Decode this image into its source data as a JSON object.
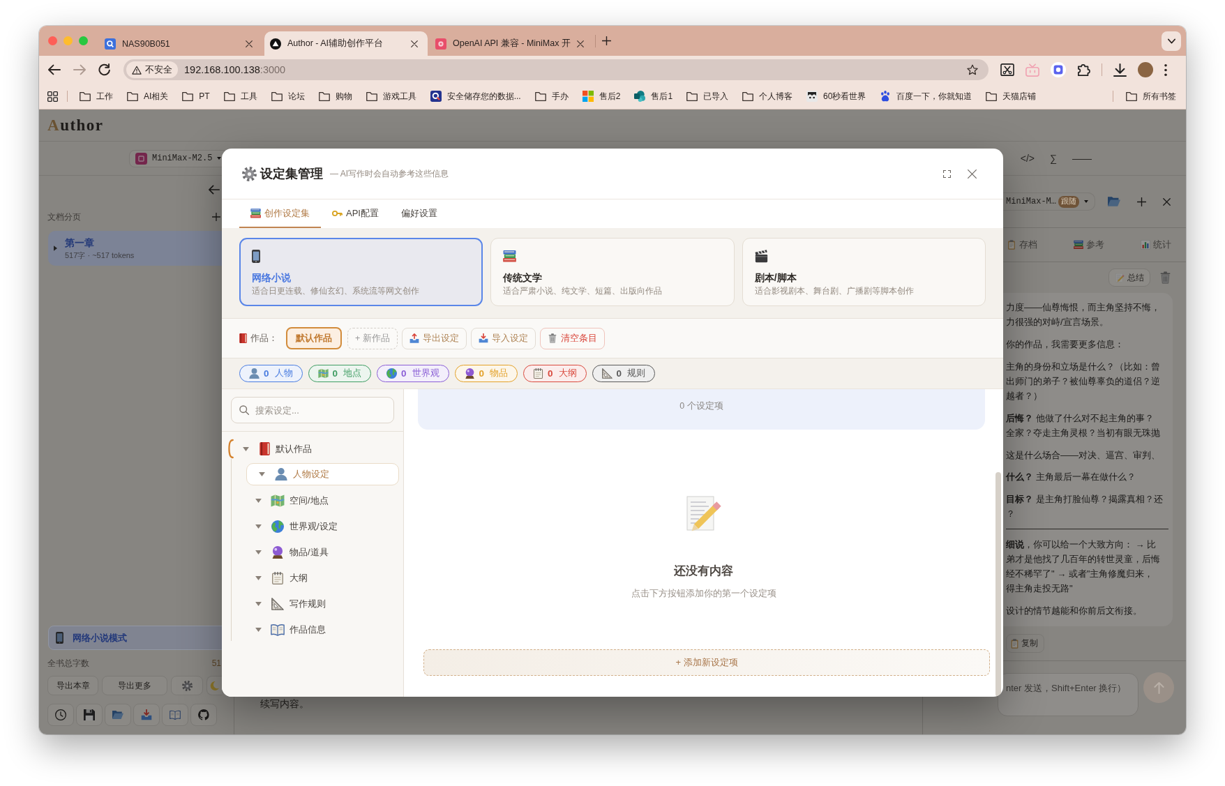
{
  "browser": {
    "tabs": [
      {
        "title": "NAS90B051",
        "selected": false
      },
      {
        "title": "Author - AI辅助创作平台",
        "selected": true
      },
      {
        "title": "OpenAI API 兼容 - MiniMax 开",
        "selected": false
      }
    ],
    "navigation": [
      {
        "kind": "back",
        "disabled": false
      },
      {
        "kind": "forward",
        "disabled": true
      },
      {
        "kind": "reload",
        "disabled": false
      }
    ],
    "address": {
      "security": "不安全",
      "host": "192.168.100.138",
      "port": ":3000"
    },
    "bookmarks": [
      {
        "kind": "folder",
        "label": "工作"
      },
      {
        "kind": "folder",
        "label": "AI相关"
      },
      {
        "kind": "folder",
        "label": "PT"
      },
      {
        "kind": "folder",
        "label": "工具"
      },
      {
        "kind": "folder",
        "label": "论坛"
      },
      {
        "kind": "folder",
        "label": "购物"
      },
      {
        "kind": "folder",
        "label": "游戏工具"
      },
      {
        "kind": "site",
        "label": "安全储存您的数据..."
      },
      {
        "kind": "folder",
        "label": "手办"
      },
      {
        "kind": "site",
        "label": "售后2"
      },
      {
        "kind": "site",
        "label": "售后1"
      },
      {
        "kind": "folder",
        "label": "已导入"
      },
      {
        "kind": "folder",
        "label": "个人博客"
      },
      {
        "kind": "site",
        "label": "60秒看世界"
      },
      {
        "kind": "site",
        "label": "百度一下，你就知道"
      },
      {
        "kind": "folder",
        "label": "天猫店铺"
      }
    ],
    "all_bookmarks": "所有书签"
  },
  "app": {
    "logo": "Author",
    "model": "MiniMax-M2.5",
    "tools": [
      "</>",
      "∑",
      "——"
    ],
    "sidebar": {
      "section_title": "文档分页",
      "chapters": [
        {
          "title": "第一章",
          "meta": "517字 · ~517 tokens",
          "selected": true,
          "expanded": false
        }
      ],
      "mode": "网络小说模式",
      "total_label": "全书总字数",
      "total_value": "51",
      "buttons": [
        "导出本章",
        "导出更多"
      ]
    },
    "editor": {
      "text": "续写内容。"
    },
    "assistant": {
      "model": "MiniMax-M…",
      "badge": "跟随",
      "tabs": [
        {
          "kind": "archive",
          "label": "存档"
        },
        {
          "kind": "reference",
          "label": "参考"
        },
        {
          "kind": "stats",
          "label": "统计"
        }
      ],
      "summary_button": "总结",
      "message": [
        {
          "kind": "paragraph",
          "lines": [
            "力度——仙尊悔恨，而主角坚持不悔，",
            "力很强的对峙/宣言场景。"
          ]
        },
        {
          "kind": "paragraph",
          "lines": [
            "你的作品，我需要更多信息："
          ]
        },
        {
          "kind": "item",
          "lines": [
            "主角的身份和立场是什么？（比如：曾",
            "出师门的弟子？被仙尊辜负的道侣？逆",
            "越者？）"
          ]
        },
        {
          "kind": "item",
          "lines": [
            "**后悔？** 他做了什么对不起主角的事？",
            "全家？夺走主角灵根？当初有眼无珠抛"
          ]
        },
        {
          "kind": "item",
          "lines": [
            "这是什么场合——对决、逼宫、审判、"
          ]
        },
        {
          "kind": "item",
          "lines": [
            "**什么？** 主角最后一幕在做什么？"
          ]
        },
        {
          "kind": "item",
          "lines": [
            "**目标？** 是主角打脸仙尊？揭露真相？还",
            "？"
          ]
        },
        {
          "kind": "rule"
        },
        {
          "kind": "paragraph",
          "lines": [
            "**细说**，你可以给一个大致方向： → 比",
            "弟才是他找了几百年的转世灵童，后悔",
            "经不稀罕了\" → 或者\"主角修魔归来，",
            "得主角走投无路\""
          ]
        },
        {
          "kind": "paragraph",
          "lines": [
            "设计的情节越能和你前后文衔接。"
          ]
        }
      ],
      "copy_button": "复制",
      "input": {
        "placeholder": "nter 发送，Shift+Enter 换行）"
      }
    }
  },
  "dialog": {
    "title": "设定集管理",
    "subtitle": "— AI写作时会自动参考这些信息",
    "tabs": [
      {
        "kind": "settings",
        "label": "创作设定集",
        "selected": true
      },
      {
        "kind": "api",
        "label": "API配置",
        "selected": false
      },
      {
        "kind": "preferences",
        "label": "偏好设置",
        "selected": false
      }
    ],
    "modes": [
      {
        "kind": "web-novel",
        "title": "网络小说",
        "description": "适合日更连载、修仙玄幻、系统流等网文创作",
        "selected": true
      },
      {
        "kind": "literature",
        "title": "传统文学",
        "description": "适合严肃小说、纯文学、短篇、出版向作品",
        "selected": false
      },
      {
        "kind": "script",
        "title": "剧本/脚本",
        "description": "适合影视剧本、舞台剧、广播剧等脚本创作",
        "selected": false
      }
    ],
    "works_label": "作品：",
    "works": [
      {
        "label": "默认作品",
        "selected": true
      }
    ],
    "actions": [
      {
        "kind": "new",
        "label": "+ 新作品"
      },
      {
        "kind": "export",
        "label": "导出设定"
      },
      {
        "kind": "import",
        "label": "导入设定"
      },
      {
        "kind": "clear",
        "label": "清空条目"
      }
    ],
    "categories": [
      {
        "kind": "character",
        "count": "0",
        "label": "人物",
        "color": "#4a7de0"
      },
      {
        "kind": "location",
        "count": "0",
        "label": "地点",
        "color": "#3f9d63"
      },
      {
        "kind": "world",
        "count": "0",
        "label": "世界观",
        "color": "#8b5fd6"
      },
      {
        "kind": "item",
        "count": "0",
        "label": "物品",
        "color": "#e3a128"
      },
      {
        "kind": "outline",
        "count": "0",
        "label": "大纲",
        "color": "#d94a3e"
      },
      {
        "kind": "rule",
        "count": "0",
        "label": "规则",
        "color": "#5a5a5a"
      }
    ],
    "search": {
      "placeholder": "搜索设定..."
    },
    "tree": [
      {
        "label": "默认作品",
        "current": true,
        "expanded": true,
        "selected": false,
        "children": [
          {
            "kind": "character",
            "label": "人物设定",
            "expanded": true,
            "selected": true
          },
          {
            "kind": "location",
            "label": "空间/地点",
            "expanded": true,
            "selected": false
          },
          {
            "kind": "world",
            "label": "世界观/设定",
            "expanded": true,
            "selected": false
          },
          {
            "kind": "item",
            "label": "物品/道具",
            "expanded": true,
            "selected": false
          },
          {
            "kind": "outline",
            "label": "大纲",
            "expanded": true,
            "selected": false
          },
          {
            "kind": "rule",
            "label": "写作规则",
            "expanded": true,
            "selected": false
          },
          {
            "kind": "info",
            "label": "作品信息",
            "expanded": true,
            "selected": false
          }
        ]
      }
    ],
    "group": {
      "count": "0 个设定项"
    },
    "empty": {
      "title": "还没有内容",
      "description": "点击下方按钮添加你的第一个设定项"
    },
    "add_button": "+ 添加新设定项"
  }
}
